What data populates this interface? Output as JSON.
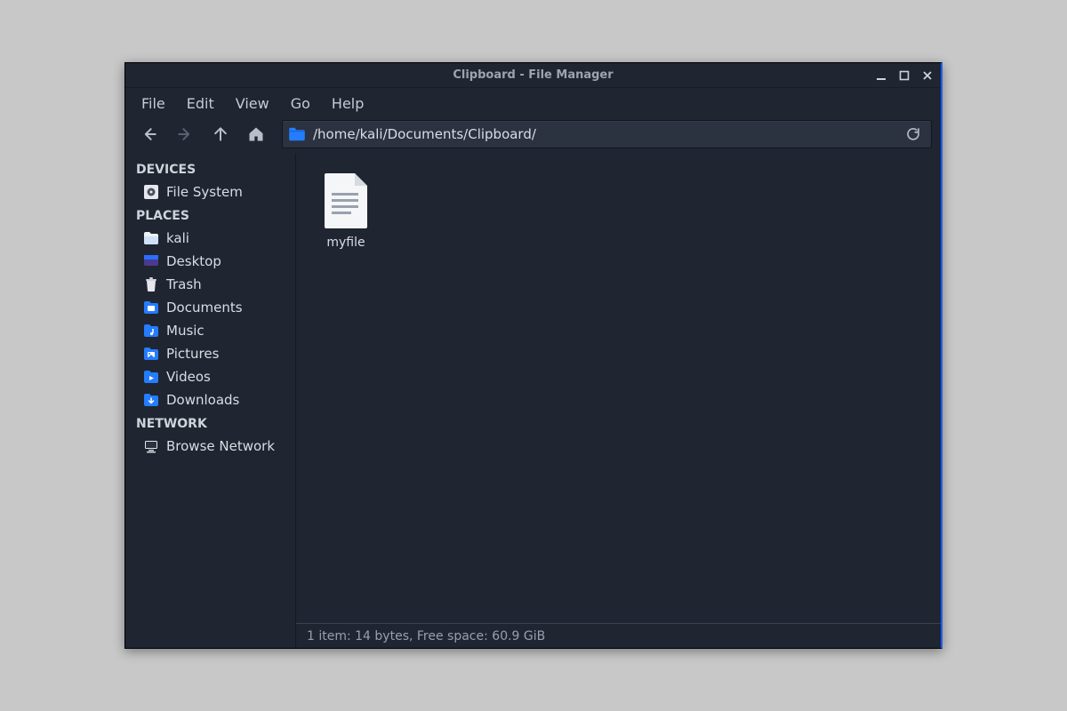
{
  "window": {
    "title": "Clipboard - File Manager"
  },
  "menubar": {
    "file": "File",
    "edit": "Edit",
    "view": "View",
    "go": "Go",
    "help": "Help"
  },
  "path": "/home/kali/Documents/Clipboard/",
  "sidebar": {
    "sections": {
      "devices": "DEVICES",
      "places": "PLACES",
      "network": "NETWORK"
    },
    "file_system": "File System",
    "kali": "kali",
    "desktop": "Desktop",
    "trash": "Trash",
    "documents": "Documents",
    "music": "Music",
    "pictures": "Pictures",
    "videos": "Videos",
    "downloads": "Downloads",
    "browse_network": "Browse Network"
  },
  "files": [
    {
      "name": "myfile",
      "type": "text"
    }
  ],
  "statusbar": "1 item: 14 bytes, Free space: 60.9 GiB",
  "colors": {
    "accent": "#247cff",
    "bg": "#1f2531",
    "text": "#d9dde4"
  }
}
